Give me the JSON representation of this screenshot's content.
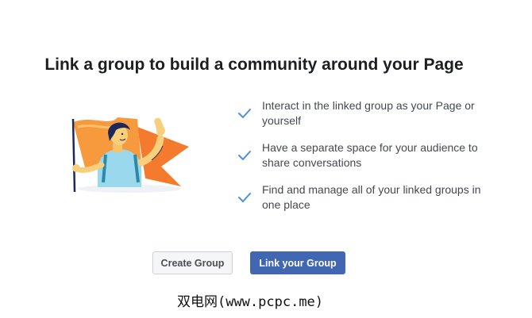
{
  "dialog": {
    "title": "Link a group to build a community around your Page"
  },
  "features": [
    {
      "icon": "checkmark-icon",
      "text": "Interact in the linked group as your Page or yourself"
    },
    {
      "icon": "checkmark-icon",
      "text": "Have a separate space for your audience to share conversations"
    },
    {
      "icon": "checkmark-icon",
      "text": "Find and manage all of your linked groups in one place"
    }
  ],
  "buttons": {
    "secondary_label": "Create Group",
    "primary_label": "Link your Group"
  },
  "watermark": {
    "text": "双电网(www.pcpc.me)"
  },
  "colors": {
    "accent": "#4267b2",
    "check": "#4a90e2",
    "flag": "#f47b2e",
    "shirt": "#9ad8ee"
  }
}
